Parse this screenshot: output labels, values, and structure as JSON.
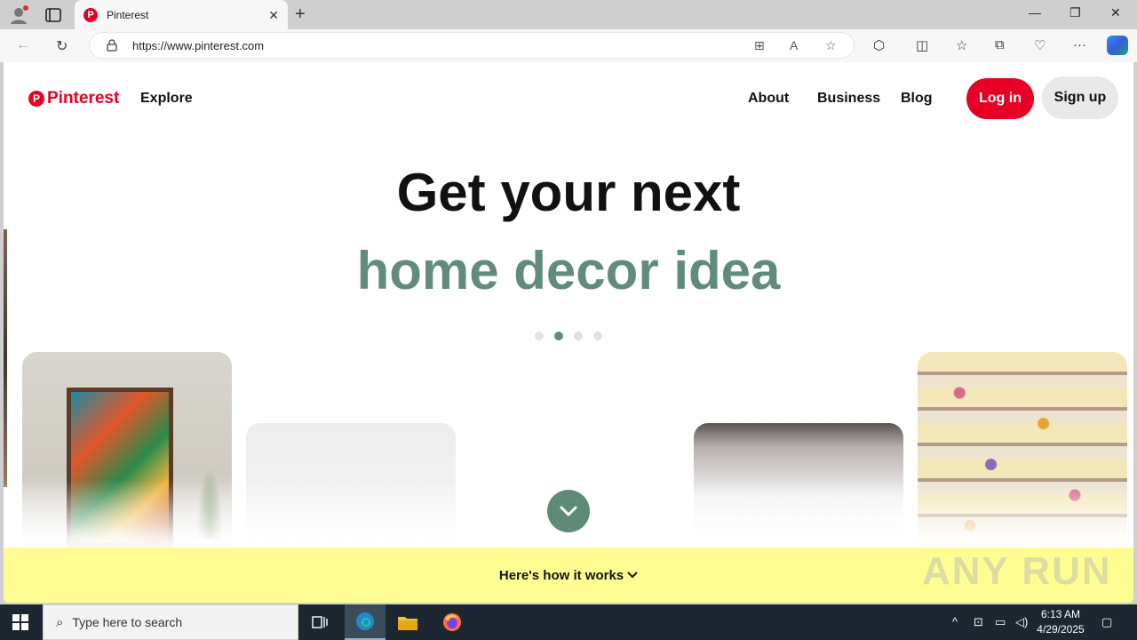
{
  "browser": {
    "tab_title": "Pinterest",
    "url": "https://www.pinterest.com"
  },
  "site": {
    "logo_text": "Pinterest",
    "explore_label": "Explore",
    "nav": [
      "About",
      "Business",
      "Blog"
    ],
    "login_label": "Log in",
    "signup_label": "Sign up",
    "brand_color": "#e60023",
    "accent_color": "#618c7b"
  },
  "hero": {
    "line1": "Get your next",
    "line2": "home decor idea",
    "carousel_total": 4,
    "carousel_active": 2
  },
  "footer_bar": {
    "label": "Here's how it works",
    "color": "#fffd92"
  },
  "watermark": "ANY RUN",
  "taskbar": {
    "search_placeholder": "Type here to search",
    "time": "6:13 AM",
    "date": "4/29/2025"
  }
}
